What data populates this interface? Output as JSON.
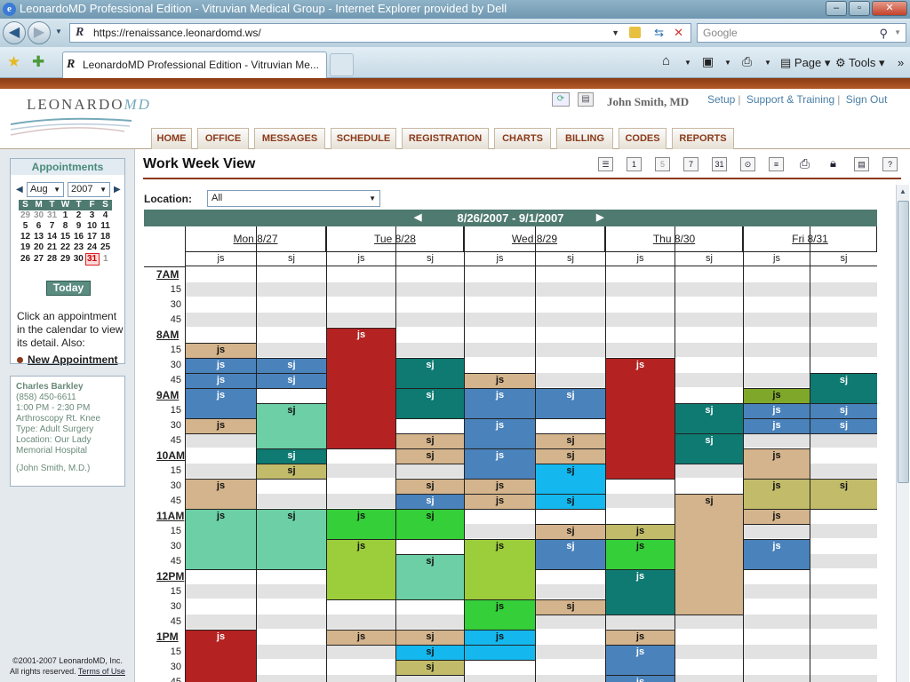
{
  "window": {
    "title": "LeonardoMD Professional Edition - Vitruvian Medical Group - Internet Explorer provided by Dell"
  },
  "browser": {
    "url": "https://renaissance.leonardomd.ws/",
    "search_placeholder": "Google",
    "tab_title": "LeonardoMD Professional Edition - Vitruvian Me...",
    "commands": {
      "page": "Page",
      "tools": "Tools"
    }
  },
  "header": {
    "logo_word": "LEONARDO",
    "logo_md": "MD",
    "user": "John Smith, MD",
    "links": [
      "Setup",
      "Support & Training",
      "Sign Out"
    ]
  },
  "nav": [
    "HOME",
    "OFFICE",
    "MESSAGES",
    "SCHEDULE",
    "REGISTRATION",
    "CHARTS",
    "BILLING",
    "CODES",
    "REPORTS"
  ],
  "sidebar": {
    "title": "Appointments",
    "month": "Aug",
    "year": "2007",
    "dow": [
      "S",
      "M",
      "T",
      "W",
      "T",
      "F",
      "S"
    ],
    "weeks": [
      [
        "29",
        "30",
        "31",
        "1",
        "2",
        "3",
        "4"
      ],
      [
        "5",
        "6",
        "7",
        "8",
        "9",
        "10",
        "11"
      ],
      [
        "12",
        "13",
        "14",
        "15",
        "16",
        "17",
        "18"
      ],
      [
        "19",
        "20",
        "21",
        "22",
        "23",
        "24",
        "25"
      ],
      [
        "26",
        "27",
        "28",
        "29",
        "30",
        "31",
        "1"
      ]
    ],
    "today_button": "Today",
    "hint": "Click an appointment in the calendar to view its detail. Also:",
    "new_appointment": "New Appointment",
    "detail": [
      "Charles Barkley",
      "(858) 450-6611",
      "1:00 PM - 2:30 PM",
      "Arthroscopy Rt. Knee",
      "Type: Adult Surgery",
      "Location: Our Lady",
      "Memorial Hospital",
      "",
      "(John Smith, M.D.)"
    ],
    "footer_line1": "©2001-2007 LeonardoMD, Inc.",
    "footer_line2_prefix": "All rights reserved.",
    "footer_terms": "Terms of Use"
  },
  "main": {
    "title": "Work Week View",
    "location_label": "Location:",
    "location_value": "All",
    "week_range": "8/26/2007 - 9/1/2007",
    "days": [
      "Mon 8/27",
      "Tue 8/28",
      "Wed 8/29",
      "Thu 8/30",
      "Fri 8/31"
    ],
    "providers": [
      "js",
      "sj"
    ],
    "time_labels": [
      "7AM",
      "15",
      "30",
      "45",
      "8AM",
      "15",
      "30",
      "45",
      "9AM",
      "15",
      "30",
      "45",
      "10AM",
      "15",
      "30",
      "45",
      "11AM",
      "15",
      "30",
      "45",
      "12PM",
      "15",
      "30",
      "45",
      "1PM",
      "15",
      "30",
      "45"
    ],
    "colors": {
      "tan": "#d4b48c",
      "blue": "#4a82bb",
      "red": "#b52222",
      "teal": "#0e7a72",
      "mint": "#6ccfa6",
      "olive": "#c2bc6a",
      "cyan": "#14b8ee",
      "green": "#35cf3a",
      "lime": "#9ccd3a",
      "dkolive": "#7fa82a",
      "brand": "#8b3a1a",
      "bar": "#4f7a70"
    },
    "appointments": [
      {
        "day": 0,
        "prov": 0,
        "start": 5,
        "len": 1,
        "color": "tan",
        "label": "js"
      },
      {
        "day": 0,
        "prov": 0,
        "start": 6,
        "len": 1,
        "color": "blue",
        "label": "js"
      },
      {
        "day": 0,
        "prov": 0,
        "start": 7,
        "len": 1,
        "color": "blue",
        "label": "js"
      },
      {
        "day": 0,
        "prov": 0,
        "start": 8,
        "len": 2,
        "color": "blue",
        "label": "js"
      },
      {
        "day": 0,
        "prov": 0,
        "start": 10,
        "len": 1,
        "color": "tan",
        "label": "js"
      },
      {
        "day": 0,
        "prov": 0,
        "start": 14,
        "len": 2,
        "color": "tan",
        "label": "js"
      },
      {
        "day": 0,
        "prov": 0,
        "start": 16,
        "len": 4,
        "color": "mint",
        "label": "js"
      },
      {
        "day": 0,
        "prov": 0,
        "start": 24,
        "len": 4,
        "color": "red",
        "label": "js"
      },
      {
        "day": 0,
        "prov": 1,
        "start": 6,
        "len": 1,
        "color": "blue",
        "label": "sj"
      },
      {
        "day": 0,
        "prov": 1,
        "start": 7,
        "len": 1,
        "color": "blue",
        "label": "sj"
      },
      {
        "day": 0,
        "prov": 1,
        "start": 9,
        "len": 3,
        "color": "mint",
        "label": "sj"
      },
      {
        "day": 0,
        "prov": 1,
        "start": 12,
        "len": 1,
        "color": "teal",
        "label": "sj"
      },
      {
        "day": 0,
        "prov": 1,
        "start": 13,
        "len": 1,
        "color": "olive",
        "label": "sj"
      },
      {
        "day": 0,
        "prov": 1,
        "start": 16,
        "len": 4,
        "color": "mint",
        "label": "sj"
      },
      {
        "day": 1,
        "prov": 0,
        "start": 4,
        "len": 8,
        "color": "red",
        "label": "js"
      },
      {
        "day": 1,
        "prov": 0,
        "start": 16,
        "len": 2,
        "color": "green",
        "label": "js"
      },
      {
        "day": 1,
        "prov": 0,
        "start": 18,
        "len": 4,
        "color": "lime",
        "label": "js"
      },
      {
        "day": 1,
        "prov": 0,
        "start": 24,
        "len": 1,
        "color": "tan",
        "label": "js"
      },
      {
        "day": 1,
        "prov": 1,
        "start": 6,
        "len": 2,
        "color": "teal",
        "label": "sj"
      },
      {
        "day": 1,
        "prov": 1,
        "start": 8,
        "len": 2,
        "color": "teal",
        "label": "sj"
      },
      {
        "day": 1,
        "prov": 1,
        "start": 11,
        "len": 1,
        "color": "tan",
        "label": "sj"
      },
      {
        "day": 1,
        "prov": 1,
        "start": 12,
        "len": 1,
        "color": "tan",
        "label": "sj"
      },
      {
        "day": 1,
        "prov": 1,
        "start": 14,
        "len": 1,
        "color": "tan",
        "label": "sj"
      },
      {
        "day": 1,
        "prov": 1,
        "start": 15,
        "len": 1,
        "color": "blue",
        "label": "sj"
      },
      {
        "day": 1,
        "prov": 1,
        "start": 16,
        "len": 2,
        "color": "green",
        "label": "sj"
      },
      {
        "day": 1,
        "prov": 1,
        "start": 19,
        "len": 3,
        "color": "mint",
        "label": "sj"
      },
      {
        "day": 1,
        "prov": 1,
        "start": 24,
        "len": 1,
        "color": "tan",
        "label": "sj"
      },
      {
        "day": 1,
        "prov": 1,
        "start": 25,
        "len": 1,
        "color": "cyan",
        "label": "sj"
      },
      {
        "day": 1,
        "prov": 1,
        "start": 26,
        "len": 1,
        "color": "olive",
        "label": "sj"
      },
      {
        "day": 2,
        "prov": 0,
        "start": 7,
        "len": 1,
        "color": "tan",
        "label": "js"
      },
      {
        "day": 2,
        "prov": 0,
        "start": 8,
        "len": 2,
        "color": "blue",
        "label": "js"
      },
      {
        "day": 2,
        "prov": 0,
        "start": 10,
        "len": 2,
        "color": "blue",
        "label": "js"
      },
      {
        "day": 2,
        "prov": 0,
        "start": 12,
        "len": 2,
        "color": "blue",
        "label": "js"
      },
      {
        "day": 2,
        "prov": 0,
        "start": 14,
        "len": 1,
        "color": "tan",
        "label": "js"
      },
      {
        "day": 2,
        "prov": 0,
        "start": 15,
        "len": 1,
        "color": "tan",
        "label": "js"
      },
      {
        "day": 2,
        "prov": 0,
        "start": 18,
        "len": 4,
        "color": "lime",
        "label": "js"
      },
      {
        "day": 2,
        "prov": 0,
        "start": 22,
        "len": 2,
        "color": "green",
        "label": "js"
      },
      {
        "day": 2,
        "prov": 0,
        "start": 24,
        "len": 1,
        "color": "cyan",
        "label": "js"
      },
      {
        "day": 2,
        "prov": 0,
        "start": 25,
        "len": 1,
        "color": "cyan",
        "label": ""
      },
      {
        "day": 2,
        "prov": 1,
        "start": 8,
        "len": 2,
        "color": "blue",
        "label": "sj"
      },
      {
        "day": 2,
        "prov": 1,
        "start": 11,
        "len": 1,
        "color": "tan",
        "label": "sj"
      },
      {
        "day": 2,
        "prov": 1,
        "start": 12,
        "len": 1,
        "color": "tan",
        "label": "sj"
      },
      {
        "day": 2,
        "prov": 1,
        "start": 13,
        "len": 2,
        "color": "cyan",
        "label": "sj"
      },
      {
        "day": 2,
        "prov": 1,
        "start": 15,
        "len": 1,
        "color": "cyan",
        "label": "sj"
      },
      {
        "day": 2,
        "prov": 1,
        "start": 17,
        "len": 1,
        "color": "tan",
        "label": "sj"
      },
      {
        "day": 2,
        "prov": 1,
        "start": 18,
        "len": 2,
        "color": "blue",
        "label": "sj"
      },
      {
        "day": 2,
        "prov": 1,
        "start": 22,
        "len": 1,
        "color": "tan",
        "label": "sj"
      },
      {
        "day": 3,
        "prov": 0,
        "start": 6,
        "len": 8,
        "color": "red",
        "label": "js"
      },
      {
        "day": 3,
        "prov": 0,
        "start": 17,
        "len": 1,
        "color": "olive",
        "label": "js"
      },
      {
        "day": 3,
        "prov": 0,
        "start": 18,
        "len": 2,
        "color": "green",
        "label": "js"
      },
      {
        "day": 3,
        "prov": 0,
        "start": 20,
        "len": 3,
        "color": "teal",
        "label": "js"
      },
      {
        "day": 3,
        "prov": 0,
        "start": 24,
        "len": 1,
        "color": "tan",
        "label": "js"
      },
      {
        "day": 3,
        "prov": 0,
        "start": 25,
        "len": 2,
        "color": "blue",
        "label": "js"
      },
      {
        "day": 3,
        "prov": 0,
        "start": 27,
        "len": 1,
        "color": "blue",
        "label": "js"
      },
      {
        "day": 3,
        "prov": 1,
        "start": 9,
        "len": 2,
        "color": "teal",
        "label": "sj"
      },
      {
        "day": 3,
        "prov": 1,
        "start": 11,
        "len": 2,
        "color": "teal",
        "label": "sj"
      },
      {
        "day": 3,
        "prov": 1,
        "start": 15,
        "len": 8,
        "color": "tan",
        "label": "sj"
      },
      {
        "day": 4,
        "prov": 0,
        "start": 8,
        "len": 1,
        "color": "dkolive",
        "label": "js"
      },
      {
        "day": 4,
        "prov": 0,
        "start": 9,
        "len": 1,
        "color": "blue",
        "label": "js"
      },
      {
        "day": 4,
        "prov": 0,
        "start": 10,
        "len": 1,
        "color": "blue",
        "label": "js"
      },
      {
        "day": 4,
        "prov": 0,
        "start": 12,
        "len": 2,
        "color": "tan",
        "label": "js"
      },
      {
        "day": 4,
        "prov": 0,
        "start": 14,
        "len": 2,
        "color": "olive",
        "label": "js"
      },
      {
        "day": 4,
        "prov": 0,
        "start": 16,
        "len": 1,
        "color": "tan",
        "label": "js"
      },
      {
        "day": 4,
        "prov": 0,
        "start": 18,
        "len": 2,
        "color": "blue",
        "label": "js"
      },
      {
        "day": 4,
        "prov": 1,
        "start": 7,
        "len": 2,
        "color": "teal",
        "label": "sj"
      },
      {
        "day": 4,
        "prov": 1,
        "start": 9,
        "len": 1,
        "color": "blue",
        "label": "sj"
      },
      {
        "day": 4,
        "prov": 1,
        "start": 10,
        "len": 1,
        "color": "blue",
        "label": "sj"
      },
      {
        "day": 4,
        "prov": 1,
        "start": 14,
        "len": 2,
        "color": "olive",
        "label": "sj"
      }
    ]
  }
}
